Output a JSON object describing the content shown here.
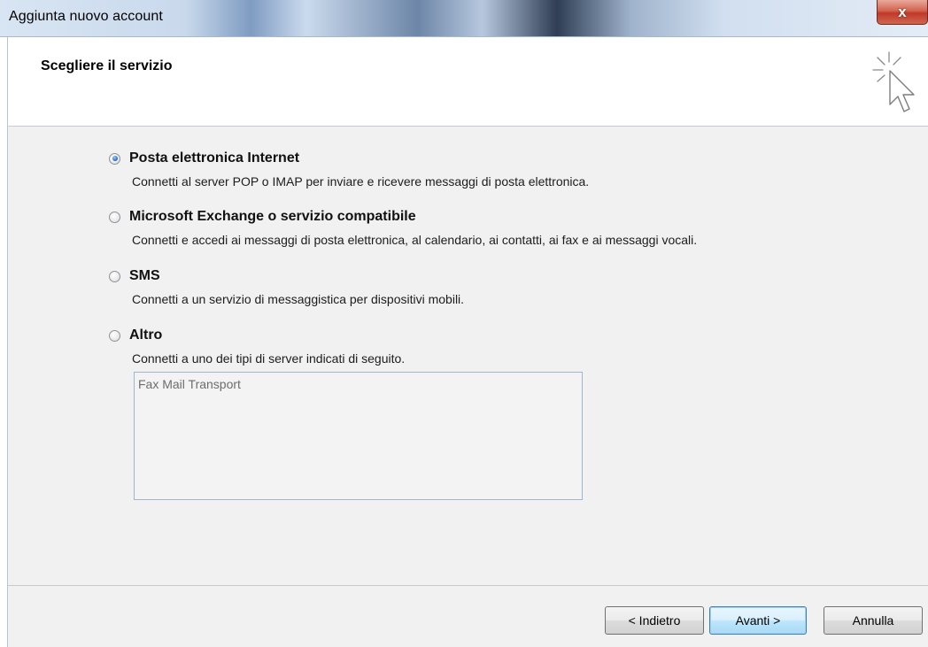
{
  "window": {
    "title": "Aggiunta nuovo account",
    "close_glyph": "x"
  },
  "header": {
    "title": "Scegliere il servizio",
    "icon": "wizard-cursor-icon"
  },
  "options": [
    {
      "label": "Posta elettronica Internet",
      "description": "Connetti al server POP o IMAP per inviare e ricevere messaggi di posta elettronica.",
      "selected": true
    },
    {
      "label": "Microsoft Exchange o servizio compatibile",
      "description": "Connetti e accedi ai messaggi di posta elettronica, al calendario, ai contatti, ai fax e ai messaggi vocali.",
      "selected": false
    },
    {
      "label": "SMS",
      "description": "Connetti a un servizio di messaggistica per dispositivi mobili.",
      "selected": false
    },
    {
      "label": "Altro",
      "description": "Connetti a uno dei tipi di server indicati di seguito.",
      "selected": false
    }
  ],
  "server_list": {
    "items": [
      "Fax Mail Transport"
    ]
  },
  "buttons": {
    "back": "< Indietro",
    "next": "Avanti >",
    "cancel": "Annulla"
  },
  "colors": {
    "close_button": "#c0392b",
    "default_button_border": "#3c7fb1",
    "content_background": "#f1f1f1",
    "radio_selected": "#2e72c8"
  }
}
